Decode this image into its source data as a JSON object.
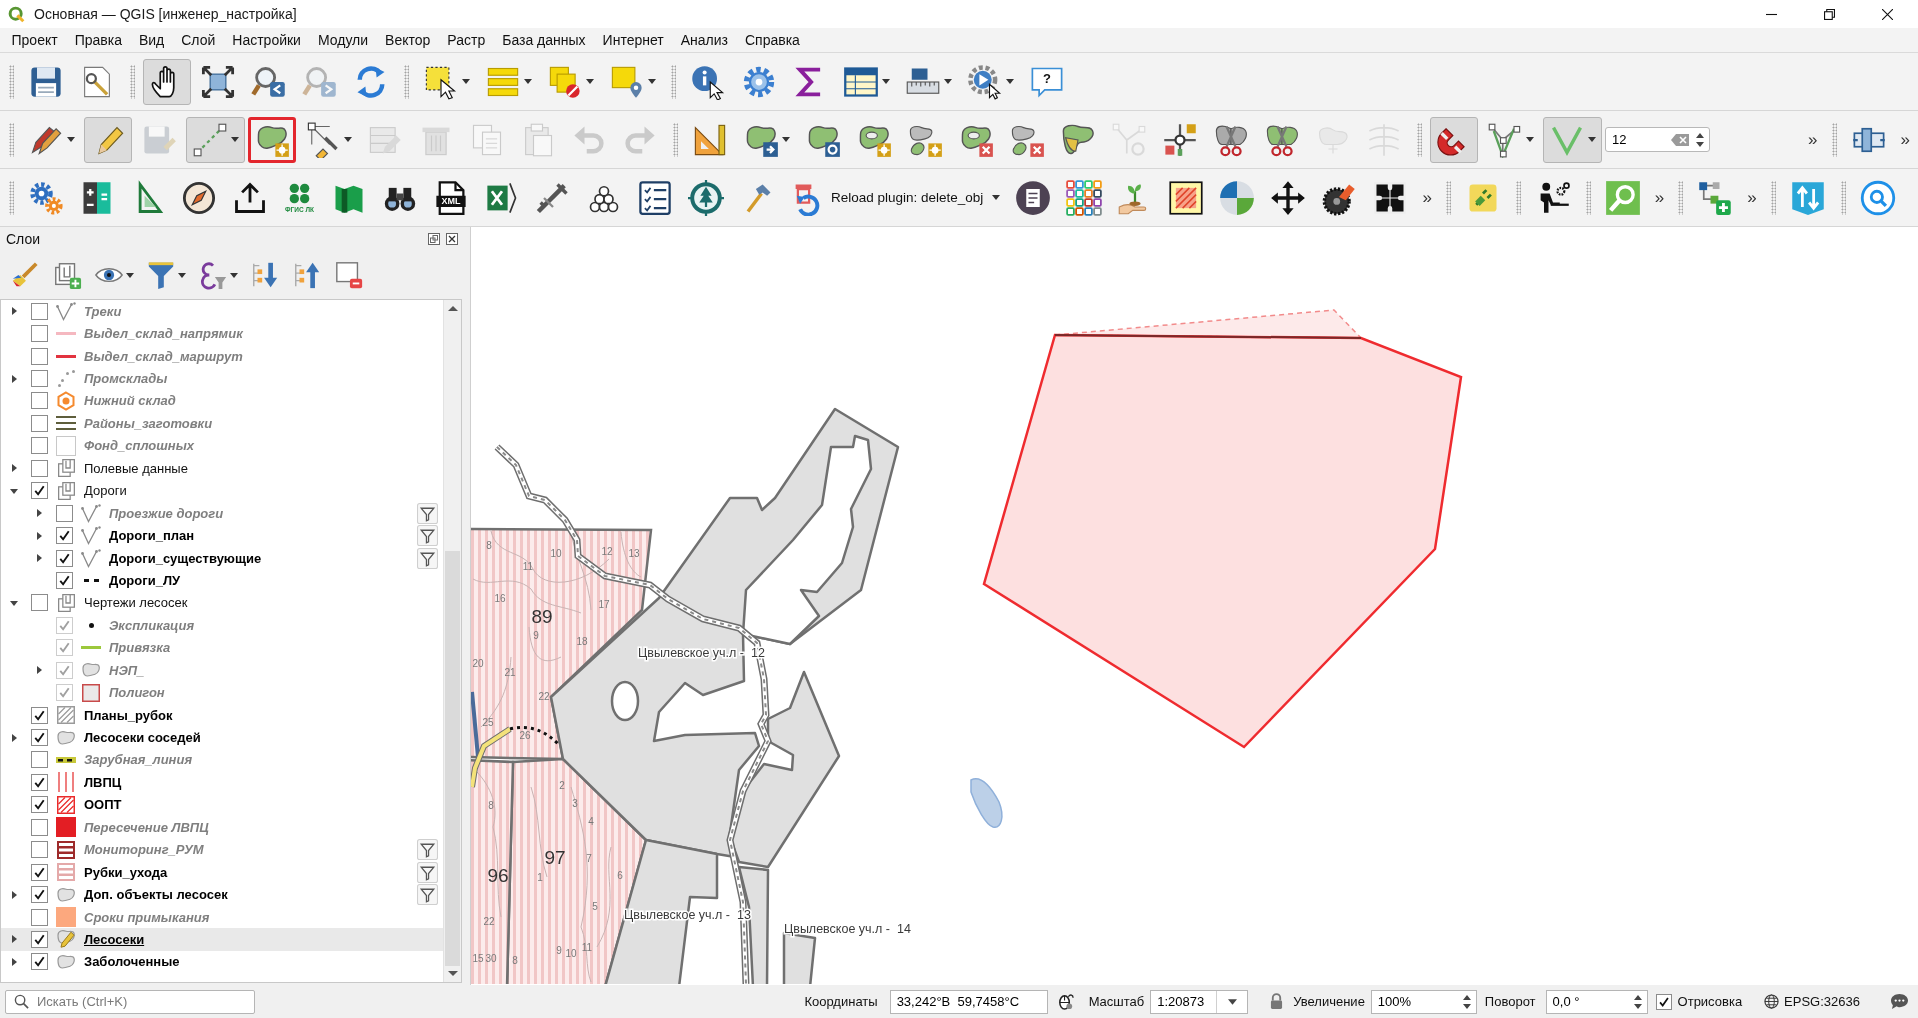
{
  "window": {
    "title": "Основная — QGIS [инженер_настройка]"
  },
  "menu_bar": [
    "Проект",
    "Правка",
    "Вид",
    "Слой",
    "Настройки",
    "Модули",
    "Вектор",
    "Растр",
    "База данных",
    "Интернет",
    "Анализ",
    "Справка"
  ],
  "toolbars": [
    {
      "groups": [
        {
          "items": [
            {
              "kind": "button",
              "on": false,
              "disabled": false,
              "menu": false,
              "highlighted": false
            },
            {
              "kind": "button",
              "on": false,
              "disabled": false,
              "menu": false,
              "highlighted": false
            }
          ]
        },
        {
          "items": [
            {
              "kind": "button",
              "on": true,
              "disabled": false,
              "menu": false,
              "highlighted": false
            },
            {
              "kind": "button",
              "on": false,
              "disabled": false,
              "menu": false,
              "highlighted": false
            },
            {
              "kind": "button",
              "on": false,
              "disabled": false,
              "menu": false,
              "highlighted": false
            },
            {
              "kind": "button",
              "on": false,
              "disabled": true,
              "menu": false,
              "highlighted": false
            },
            {
              "kind": "button",
              "on": false,
              "disabled": false,
              "menu": false,
              "highlighted": false
            }
          ]
        },
        {
          "items": [
            {
              "kind": "button",
              "on": false,
              "disabled": false,
              "menu": true,
              "highlighted": false
            },
            {
              "kind": "button",
              "on": false,
              "disabled": false,
              "menu": true,
              "highlighted": false
            },
            {
              "kind": "button",
              "on": false,
              "disabled": false,
              "menu": true,
              "highlighted": false
            },
            {
              "kind": "button",
              "on": false,
              "disabled": false,
              "menu": true,
              "highlighted": false
            }
          ]
        },
        {
          "items": [
            {
              "kind": "button",
              "on": false,
              "disabled": false,
              "menu": false,
              "highlighted": false
            },
            {
              "kind": "button",
              "on": false,
              "disabled": false,
              "menu": false,
              "highlighted": false
            },
            {
              "kind": "button",
              "on": false,
              "disabled": false,
              "menu": false,
              "highlighted": false
            },
            {
              "kind": "button",
              "on": false,
              "disabled": false,
              "menu": true,
              "highlighted": false
            },
            {
              "kind": "button",
              "on": false,
              "disabled": false,
              "menu": true,
              "highlighted": false
            },
            {
              "kind": "button",
              "on": false,
              "disabled": false,
              "menu": true,
              "highlighted": false
            },
            {
              "kind": "button",
              "label": "?",
              "on": false,
              "disabled": false,
              "menu": false,
              "highlighted": false
            }
          ]
        }
      ]
    },
    {
      "groups": [
        {
          "items": [
            {
              "kind": "button",
              "on": false,
              "disabled": false,
              "menu": true,
              "highlighted": false
            },
            {
              "kind": "button",
              "on": true,
              "disabled": false,
              "menu": false,
              "highlighted": false
            },
            {
              "kind": "button",
              "on": false,
              "disabled": true,
              "menu": false,
              "highlighted": false
            },
            {
              "kind": "button",
              "on": true,
              "disabled": false,
              "menu": true,
              "highlighted": false
            },
            {
              "kind": "button",
              "on": false,
              "disabled": false,
              "menu": false,
              "highlighted": true
            },
            {
              "kind": "button",
              "on": false,
              "disabled": false,
              "menu": true,
              "highlighted": false
            },
            {
              "kind": "button",
              "on": false,
              "disabled": true,
              "menu": false,
              "highlighted": false
            },
            {
              "kind": "button",
              "on": false,
              "disabled": true,
              "menu": false,
              "highlighted": false
            },
            {
              "kind": "button",
              "on": false,
              "disabled": true,
              "menu": false,
              "highlighted": false
            },
            {
              "kind": "button",
              "on": false,
              "disabled": true,
              "menu": false,
              "highlighted": false
            },
            {
              "kind": "button",
              "on": false,
              "disabled": true,
              "menu": false,
              "highlighted": false
            },
            {
              "kind": "button",
              "on": false,
              "disabled": true,
              "menu": false,
              "highlighted": false
            }
          ]
        },
        {
          "items": [
            {
              "kind": "button",
              "on": false,
              "disabled": false,
              "menu": false,
              "highlighted": false
            },
            {
              "kind": "button",
              "on": false,
              "disabled": false,
              "menu": true,
              "highlighted": false
            },
            {
              "kind": "button",
              "on": false,
              "disabled": false,
              "menu": false,
              "highlighted": false
            },
            {
              "kind": "button",
              "on": false,
              "disabled": false,
              "menu": false,
              "highlighted": false
            },
            {
              "kind": "button",
              "on": false,
              "disabled": false,
              "menu": false,
              "highlighted": false
            },
            {
              "kind": "button",
              "on": false,
              "disabled": false,
              "menu": false,
              "highlighted": false
            },
            {
              "kind": "button",
              "on": false,
              "disabled": false,
              "menu": false,
              "highlighted": false
            },
            {
              "kind": "button",
              "on": false,
              "disabled": false,
              "menu": false,
              "highlighted": false
            },
            {
              "kind": "button",
              "on": false,
              "disabled": true,
              "menu": false,
              "highlighted": false
            },
            {
              "kind": "button",
              "on": false,
              "disabled": false,
              "menu": false,
              "highlighted": false
            },
            {
              "kind": "button",
              "on": false,
              "disabled": false,
              "menu": false,
              "highlighted": false
            },
            {
              "kind": "button",
              "on": false,
              "disabled": false,
              "menu": false,
              "highlighted": false
            },
            {
              "kind": "button",
              "on": false,
              "disabled": true,
              "menu": false,
              "highlighted": false
            },
            {
              "kind": "button",
              "on": false,
              "disabled": true,
              "menu": false,
              "highlighted": false
            }
          ]
        },
        {
          "items": [
            {
              "kind": "button",
              "on": true,
              "disabled": false,
              "menu": false,
              "highlighted": false
            },
            {
              "kind": "button",
              "on": false,
              "disabled": false,
              "menu": true,
              "highlighted": false
            },
            {
              "kind": "button",
              "on": true,
              "disabled": false,
              "menu": true,
              "highlighted": false
            },
            {
              "kind": "spin-field",
              "value": "12"
            },
            {
              "kind": "overflow",
              "label": "»"
            }
          ]
        },
        {
          "items": [
            {
              "kind": "button",
              "on": false,
              "disabled": false,
              "menu": false,
              "highlighted": false
            },
            {
              "kind": "overflow",
              "label": "»"
            }
          ]
        }
      ]
    },
    {
      "groups": [
        {
          "items": [
            {
              "kind": "button",
              "on": false,
              "disabled": false,
              "menu": false,
              "highlighted": false
            },
            {
              "kind": "button",
              "on": false,
              "disabled": false,
              "menu": false,
              "highlighted": false
            },
            {
              "kind": "button",
              "on": false,
              "disabled": false,
              "menu": false,
              "highlighted": false
            },
            {
              "kind": "button",
              "on": false,
              "disabled": false,
              "menu": false,
              "highlighted": false
            },
            {
              "kind": "button",
              "on": false,
              "disabled": false,
              "menu": false,
              "highlighted": false
            },
            {
              "kind": "button",
              "label": "ФГИС ЛК",
              "on": false,
              "disabled": false,
              "menu": false,
              "highlighted": false
            },
            {
              "kind": "button",
              "on": false,
              "disabled": false,
              "menu": false,
              "highlighted": false
            },
            {
              "kind": "button",
              "on": false,
              "disabled": false,
              "menu": false,
              "highlighted": false
            },
            {
              "kind": "button",
              "label": "XML",
              "on": false,
              "disabled": false,
              "menu": false,
              "highlighted": false
            },
            {
              "kind": "button",
              "on": false,
              "disabled": false,
              "menu": false,
              "highlighted": false
            },
            {
              "kind": "button",
              "on": false,
              "disabled": false,
              "menu": false,
              "highlighted": false
            },
            {
              "kind": "button",
              "on": false,
              "disabled": false,
              "menu": false,
              "highlighted": false
            },
            {
              "kind": "button",
              "on": false,
              "disabled": false,
              "menu": false,
              "highlighted": false
            },
            {
              "kind": "button",
              "on": false,
              "disabled": false,
              "menu": false,
              "highlighted": false
            },
            {
              "kind": "button",
              "on": false,
              "disabled": false,
              "menu": false,
              "highlighted": false
            },
            {
              "kind": "text-button",
              "label": "Reload plugin: delete_obj",
              "on": false,
              "disabled": false,
              "menu": true,
              "highlighted": false
            },
            {
              "kind": "button",
              "on": false,
              "disabled": false,
              "menu": false,
              "highlighted": false
            },
            {
              "kind": "button",
              "on": false,
              "disabled": false,
              "menu": false,
              "highlighted": false
            },
            {
              "kind": "button",
              "on": false,
              "disabled": false,
              "menu": false,
              "highlighted": false
            },
            {
              "kind": "button",
              "on": false,
              "disabled": false,
              "menu": false,
              "highlighted": false
            },
            {
              "kind": "button",
              "on": false,
              "disabled": false,
              "menu": false,
              "highlighted": false
            },
            {
              "kind": "button",
              "on": false,
              "disabled": false,
              "menu": false,
              "highlighted": false
            },
            {
              "kind": "button",
              "on": false,
              "disabled": false,
              "menu": false,
              "highlighted": false
            },
            {
              "kind": "button",
              "on": false,
              "disabled": false,
              "menu": false,
              "highlighted": false
            },
            {
              "kind": "overflow",
              "label": "»"
            }
          ]
        },
        {
          "items": [
            {
              "kind": "button",
              "on": false,
              "disabled": false,
              "menu": false,
              "highlighted": false
            }
          ]
        },
        {
          "items": [
            {
              "kind": "button",
              "on": false,
              "disabled": false,
              "menu": false,
              "highlighted": false
            }
          ]
        },
        {
          "items": [
            {
              "kind": "button",
              "on": false,
              "disabled": false,
              "menu": false,
              "highlighted": false
            },
            {
              "kind": "overflow",
              "label": "»"
            }
          ]
        },
        {
          "items": [
            {
              "kind": "button",
              "on": false,
              "disabled": false,
              "menu": false,
              "highlighted": false
            },
            {
              "kind": "overflow",
              "label": "»"
            }
          ]
        },
        {
          "items": [
            {
              "kind": "button",
              "on": false,
              "disabled": false,
              "menu": false,
              "highlighted": false
            }
          ]
        },
        {
          "items": [
            {
              "kind": "button",
              "on": false,
              "disabled": false,
              "menu": false,
              "highlighted": false
            }
          ]
        }
      ]
    }
  ],
  "layers_panel": {
    "title": "Слои",
    "toolbar": [
      {
        "menu": false
      },
      {
        "menu": false
      },
      {
        "menu": true
      },
      {
        "menu": true
      },
      {
        "menu": true
      },
      {
        "menu": false
      },
      {
        "menu": false
      },
      {
        "menu": false
      }
    ],
    "tree": [
      {
        "label": "Треки",
        "kind": "polyline",
        "checked": false,
        "expanded": false,
        "filtered": false,
        "selected": false
      },
      {
        "label": "Выдел_склад_напрямик",
        "kind": "line",
        "color": "#f5b8c0",
        "checked": false,
        "filtered": false,
        "selected": false
      },
      {
        "label": "Выдел_склад_маршрут",
        "kind": "line",
        "color": "#e2333f",
        "checked": false,
        "filtered": false,
        "selected": false
      },
      {
        "label": "Промсклады",
        "kind": "points",
        "checked": false,
        "expanded": false,
        "filtered": false,
        "selected": false
      },
      {
        "label": "Нижний склад",
        "kind": "hexagon",
        "color": "#f58a2e",
        "checked": false,
        "filtered": false,
        "selected": false
      },
      {
        "label": "Районы_заготовки",
        "kind": "lines",
        "color": "#5e5e3c",
        "checked": false,
        "filtered": false,
        "selected": false
      },
      {
        "label": "Фонд_сплошных",
        "kind": "empty",
        "checked": false,
        "filtered": false,
        "selected": false
      },
      {
        "label": "Полевые данные",
        "kind": "group",
        "checked": false,
        "expanded": false,
        "filtered": false,
        "selected": false
      },
      {
        "label": "Дороги",
        "kind": "group",
        "checked": true,
        "expanded": true,
        "filtered": false,
        "selected": false,
        "children": [
          {
            "label": "Проезжие дороги",
            "kind": "polyline",
            "checked": false,
            "expanded": false,
            "filtered": true,
            "selected": false
          },
          {
            "label": "Дороги_план",
            "kind": "polyline",
            "checked": true,
            "expanded": false,
            "filtered": true,
            "selected": false
          },
          {
            "label": "Дороги_существующие",
            "kind": "polyline",
            "checked": true,
            "expanded": false,
            "filtered": true,
            "selected": false
          },
          {
            "label": "Дороги_ЛУ",
            "kind": "dashes",
            "checked": true,
            "filtered": false,
            "selected": false
          }
        ]
      },
      {
        "label": "Чертежи лесосек",
        "kind": "group",
        "checked": false,
        "expanded": true,
        "filtered": false,
        "selected": false,
        "children": [
          {
            "label": "Экспликация",
            "kind": "dot",
            "checked": true,
            "filtered": false,
            "selected": false
          },
          {
            "label": "Привязка",
            "kind": "line",
            "color": "#9cc83c",
            "checked": true,
            "filtered": false,
            "selected": false
          },
          {
            "label": "НЭП_",
            "kind": "blob",
            "checked": true,
            "expanded": false,
            "filtered": false,
            "selected": false
          },
          {
            "label": "Полигон",
            "kind": "outline",
            "color": "#c84a4a",
            "checked": true,
            "filtered": false,
            "selected": false
          }
        ]
      },
      {
        "label": "Планы_рубок",
        "kind": "hatch",
        "color": "#9a9a9a",
        "checked": true,
        "filtered": false,
        "selected": false
      },
      {
        "label": "Лесосеки соседей",
        "kind": "blob",
        "checked": true,
        "expanded": false,
        "filtered": false,
        "selected": false
      },
      {
        "label": "Зарубная_линия",
        "kind": "band",
        "color": "#c8c83a",
        "checked": false,
        "filtered": false,
        "selected": false
      },
      {
        "label": "ЛВПЦ",
        "kind": "vstripes",
        "color": "#ef7f7f",
        "checked": true,
        "filtered": false,
        "selected": false
      },
      {
        "label": "ООПТ",
        "kind": "hatch",
        "color": "#ea2a2a",
        "checked": true,
        "filtered": false,
        "selected": false
      },
      {
        "label": "Пересечение ЛВПЦ",
        "kind": "fill",
        "color": "#e31e24",
        "checked": false,
        "filtered": false,
        "selected": false
      },
      {
        "label": "Мониторинг_РУМ",
        "kind": "hstripes",
        "color": "#9e2a2a",
        "checked": false,
        "filtered": true,
        "selected": false
      },
      {
        "label": "Рубки_ухода",
        "kind": "hstripes",
        "color": "#e4a9a9",
        "checked": true,
        "filtered": true,
        "selected": false
      },
      {
        "label": "Доп. объекты лесосек",
        "kind": "blob",
        "checked": true,
        "expanded": false,
        "filtered": true,
        "selected": false
      },
      {
        "label": "Сроки примыкания",
        "kind": "fill",
        "color": "#fca87e",
        "checked": false,
        "filtered": false,
        "selected": false
      },
      {
        "label": "Лесосеки",
        "kind": "editblob",
        "checked": true,
        "expanded": false,
        "filtered": false,
        "selected": true
      },
      {
        "label": "Заболоченные",
        "kind": "blob",
        "checked": true,
        "expanded": false,
        "filtered": false,
        "selected": false
      }
    ]
  },
  "map": {
    "labels": [
      {
        "text": "8",
        "kind": "compartment"
      },
      {
        "text": "10",
        "kind": "compartment"
      },
      {
        "text": "12",
        "kind": "compartment"
      },
      {
        "text": "13",
        "kind": "compartment"
      },
      {
        "text": "11",
        "kind": "compartment"
      },
      {
        "text": "16",
        "kind": "compartment"
      },
      {
        "text": "89",
        "kind": "quarter"
      },
      {
        "text": "17",
        "kind": "compartment"
      },
      {
        "text": "9",
        "kind": "compartment"
      },
      {
        "text": "18",
        "kind": "compartment"
      },
      {
        "text": "Цвылевское уч.л -  12",
        "kind": "area"
      },
      {
        "text": "20",
        "kind": "compartment"
      },
      {
        "text": "21",
        "kind": "compartment"
      },
      {
        "text": "22",
        "kind": "compartment"
      },
      {
        "text": "25",
        "kind": "compartment"
      },
      {
        "text": "26",
        "kind": "compartment"
      },
      {
        "text": "2",
        "kind": "compartment"
      },
      {
        "text": "8",
        "kind": "compartment"
      },
      {
        "text": "3",
        "kind": "compartment"
      },
      {
        "text": "4",
        "kind": "compartment"
      },
      {
        "text": "97",
        "kind": "quarter"
      },
      {
        "text": "7",
        "kind": "compartment"
      },
      {
        "text": "96",
        "kind": "quarter"
      },
      {
        "text": "1",
        "kind": "compartment"
      },
      {
        "text": "6",
        "kind": "compartment"
      },
      {
        "text": "5",
        "kind": "compartment"
      },
      {
        "text": "22",
        "kind": "compartment"
      },
      {
        "text": "Цвылевское уч.л -  13",
        "kind": "area"
      },
      {
        "text": "Цвылевское уч.л -  14",
        "kind": "area"
      },
      {
        "text": "9",
        "kind": "compartment"
      },
      {
        "text": "10",
        "kind": "compartment"
      },
      {
        "text": "11",
        "kind": "compartment"
      },
      {
        "text": "15",
        "kind": "compartment"
      },
      {
        "text": "30",
        "kind": "compartment"
      },
      {
        "text": "8",
        "kind": "compartment"
      }
    ]
  },
  "status_bar": {
    "search": {
      "placeholder": "Искать (Ctrl+K)"
    },
    "coordinate": {
      "label": "Координаты",
      "value": "33,242°В  59,7458°С"
    },
    "scale": {
      "label": "Масштаб",
      "value": "1:20873"
    },
    "magnifier": {
      "label": "Увеличение",
      "value": "100%"
    },
    "rotation": {
      "label": "Поворот",
      "value": "0,0 °"
    },
    "render": {
      "label": "Отрисовка",
      "checked": true
    },
    "crs": "EPSG:32636"
  }
}
